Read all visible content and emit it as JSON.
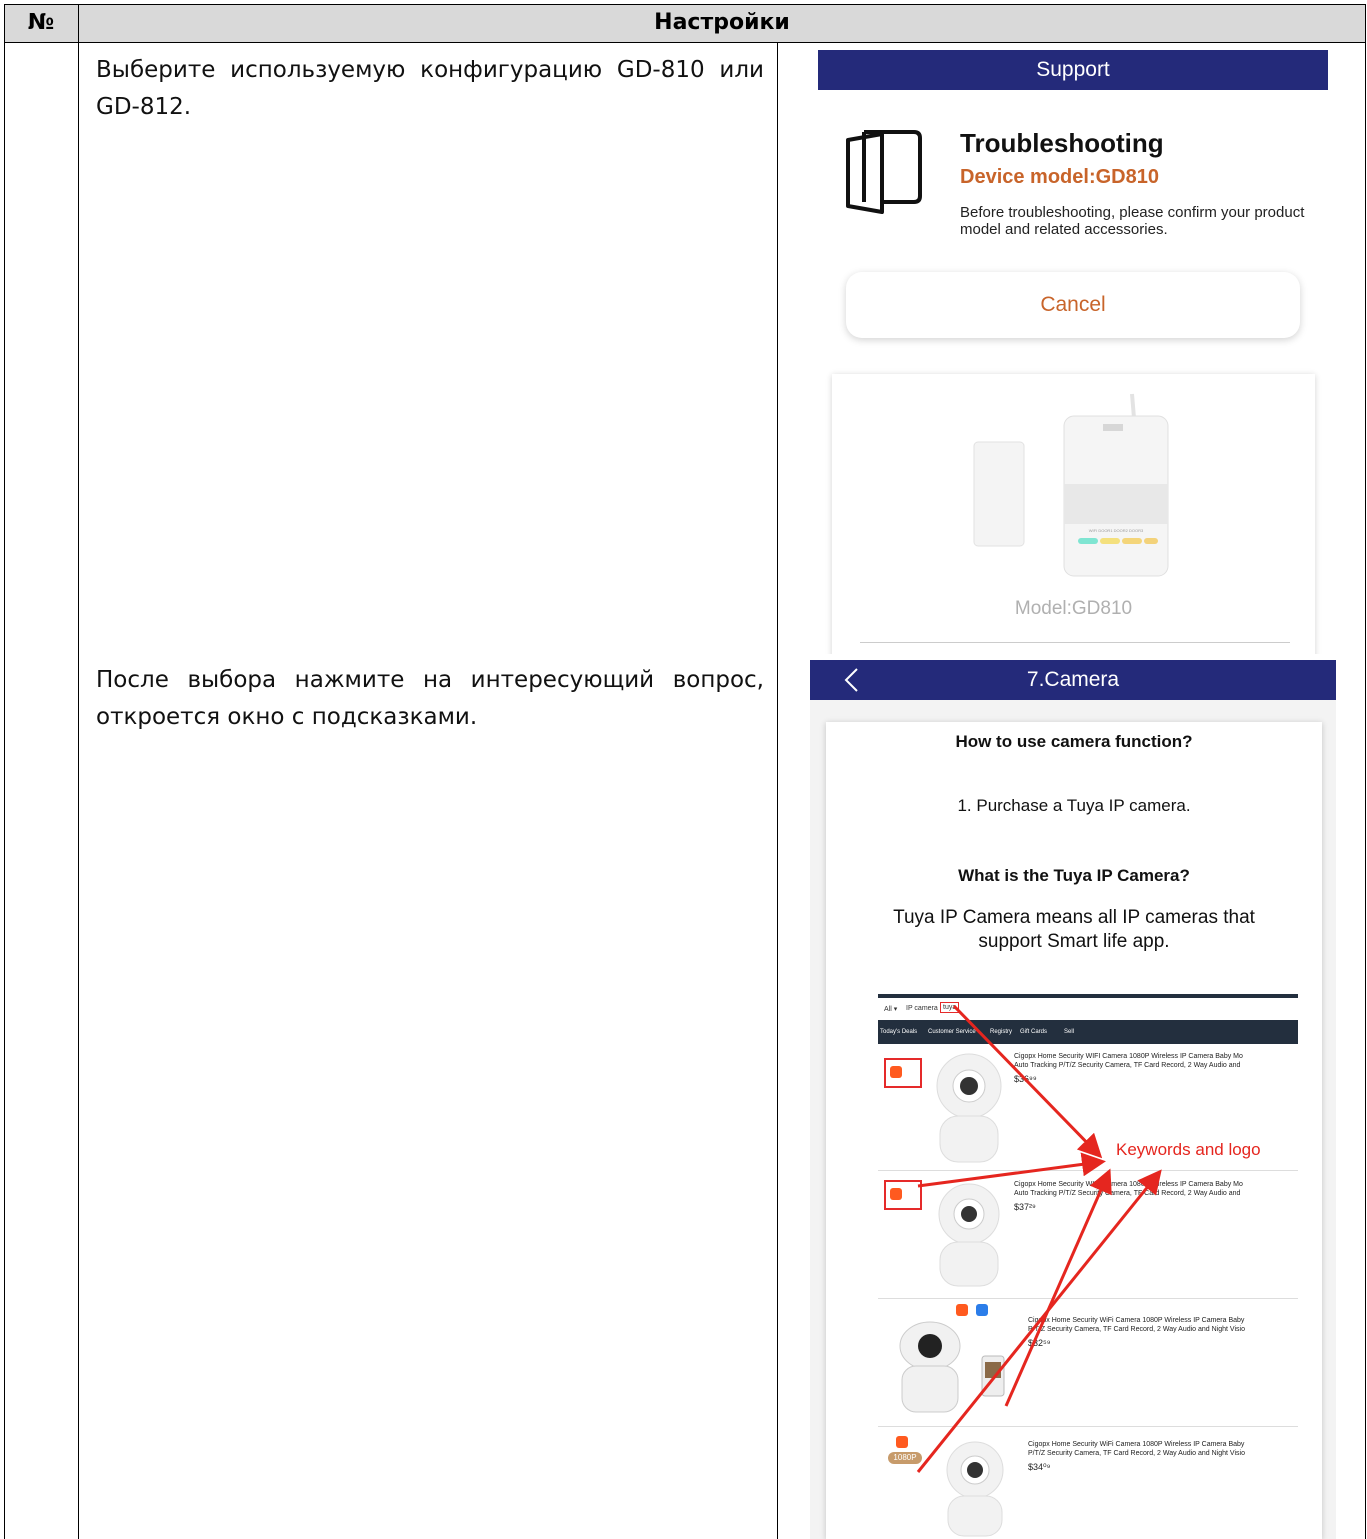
{
  "table": {
    "header_num": "№",
    "header_settings": "Настройки"
  },
  "rows": [
    {
      "text": "Выберите используемую конфигурацию GD-810 или GD-812."
    },
    {
      "text": "После выбора нажмите на интересующий вопрос, откроется окно с подсказками."
    }
  ],
  "screen1": {
    "appbar_title": "Support",
    "title": "Troubleshooting",
    "model": "Device model:GD810",
    "description": "Before troubleshooting, please confirm your product model and related accessories.",
    "cancel_label": "Cancel",
    "device_caption": "Model:GD810",
    "device_labels": "WIFI DOOR1 DOOR2 DOOR3",
    "colors": {
      "appbar": "#242a7a",
      "accent": "#c8642a"
    }
  },
  "screen2": {
    "back_icon": "chevron-left-icon",
    "appbar_title": "7.Camera",
    "q1": "How to use camera function?",
    "step1": "1. Purchase a Tuya IP camera.",
    "q2": "What is the Tuya IP Camera?",
    "answer": "Tuya IP Camera means all IP cameras that support Smart life app.",
    "shop": {
      "search_all": "All ▾",
      "search_text": "IP camera",
      "search_keyword": "tuya",
      "nav": [
        "Today's Deals",
        "Customer Service",
        "Registry",
        "Gift Cards",
        "Sell"
      ],
      "products": [
        {
          "title": "Cigopx Home Security WIFI Camera 1080P Wireless IP Camera Baby Mo",
          "title2": "Auto Tracking P/T/Z Security Camera, TF Card Record, 2 Way Audio and",
          "price": "$36⁹⁹"
        },
        {
          "title": "Cigopx Home Security WIFI Camera 1080P Wireless IP Camera Baby Mo",
          "title2": "Auto Tracking P/T/Z Security Camera, TF Card Record, 2 Way Audio and",
          "price": "$37²⁹"
        },
        {
          "title": "Cigopx Home Security WiFi Camera 1080P Wireless IP Camera Baby",
          "title2": "P/T/Z Security Camera, TF Card Record, 2 Way Audio and Night Visio",
          "price": "$32⁵⁹"
        },
        {
          "title": "Cigopx Home Security WiFi Camera 1080P Wireless IP Camera Baby",
          "title2": "P/T/Z Security Camera, TF Card Record, 2 Way Audio and Night Visio",
          "price": "$34⁰⁹"
        }
      ],
      "annotation": "Keywords and logo",
      "badge_1080p": "1080P",
      "annotation_color": "#e5261f"
    }
  }
}
